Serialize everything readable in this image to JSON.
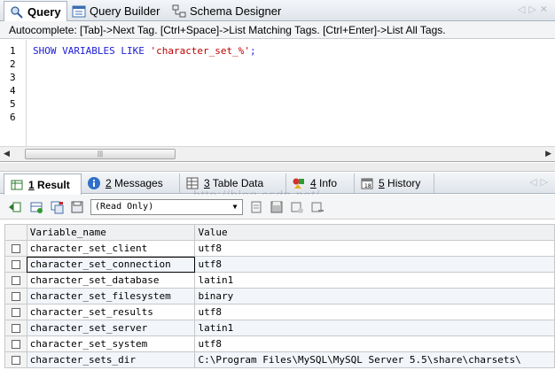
{
  "top_tabs": {
    "query": "Query",
    "query_builder": "Query Builder",
    "schema_designer": "Schema Designer"
  },
  "autocomplete_hint": "Autocomplete: [Tab]->Next Tag. [Ctrl+Space]->List Matching Tags. [Ctrl+Enter]->List All Tags.",
  "editor": {
    "line_numbers": [
      "1",
      "2",
      "3",
      "4",
      "5",
      "6"
    ],
    "code_keyword": "SHOW VARIABLES LIKE ",
    "code_string": "'character_set_%'",
    "code_end": ";"
  },
  "result_tabs": {
    "result": {
      "num": "1",
      "label": " Result"
    },
    "messages": {
      "num": "2",
      "label": " Messages"
    },
    "table_data": {
      "num": "3",
      "label": " Table Data"
    },
    "info": {
      "num": "4",
      "label": " Info"
    },
    "history": {
      "num": "5",
      "label": " History"
    }
  },
  "watermark": "http://blog.csdn.net/",
  "toolbar": {
    "mode_select": "(Read Only)"
  },
  "grid": {
    "columns": [
      "Variable_name",
      "Value"
    ],
    "rows": [
      [
        "character_set_client",
        "utf8"
      ],
      [
        "character_set_connection",
        "utf8"
      ],
      [
        "character_set_database",
        "latin1"
      ],
      [
        "character_set_filesystem",
        "binary"
      ],
      [
        "character_set_results",
        "utf8"
      ],
      [
        "character_set_server",
        "latin1"
      ],
      [
        "character_set_system",
        "utf8"
      ],
      [
        "character_sets_dir",
        "C:\\Program Files\\MySQL\\MySQL Server 5.5\\share\\charsets\\"
      ]
    ]
  },
  "colors": {
    "keyword": "#1c1cd6",
    "string": "#c00000",
    "tab_gradient_top": "#f4f6f9",
    "tab_gradient_bottom": "#dfe4ea"
  }
}
